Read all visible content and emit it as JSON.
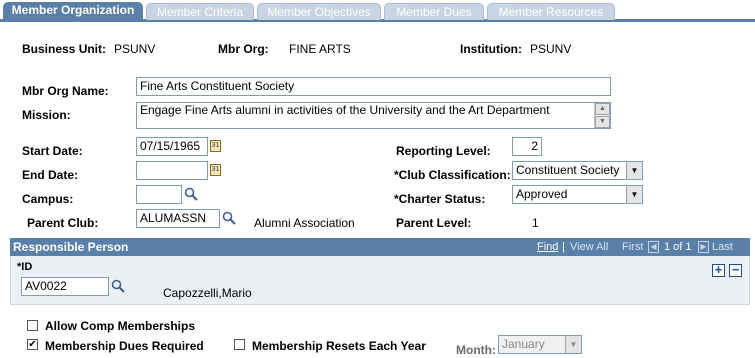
{
  "tabs": [
    {
      "label": "Member Organization",
      "active": true
    },
    {
      "label": "Member Criteria",
      "active": false
    },
    {
      "label": "Member Objectives",
      "active": false
    },
    {
      "label": "Member Dues",
      "active": false
    },
    {
      "label": "Member Resources",
      "active": false
    }
  ],
  "header": {
    "business_unit_label": "Business Unit:",
    "business_unit_value": "PSUNV",
    "mbr_org_label": "Mbr Org:",
    "mbr_org_value": "FINE ARTS",
    "institution_label": "Institution:",
    "institution_value": "PSUNV"
  },
  "form": {
    "mbr_org_name_label": "Mbr Org Name:",
    "mbr_org_name_value": "Fine Arts Constituent Society",
    "mission_label": "Mission:",
    "mission_value": "Engage Fine Arts alumni in activities of the University and the Art Department",
    "start_date_label": "Start Date:",
    "start_date_value": "07/15/1965",
    "end_date_label": "End Date:",
    "end_date_value": "",
    "campus_label": "Campus:",
    "campus_value": "",
    "parent_club_label": "Parent Club:",
    "parent_club_value": "ALUMASSN",
    "parent_club_desc": "Alumni Association",
    "reporting_level_label": "Reporting Level:",
    "reporting_level_value": "2",
    "club_classification_label": "*Club Classification:",
    "club_classification_value": "Constituent Society",
    "charter_status_label": "*Charter Status:",
    "charter_status_value": "Approved",
    "parent_level_label": "Parent Level:",
    "parent_level_value": "1"
  },
  "responsible_person": {
    "title": "Responsible Person",
    "find_label": "Find",
    "separator": "|",
    "view_all_label": "View All",
    "first_label": "First",
    "range_label": "1 of 1",
    "last_label": "Last",
    "id_label": "*ID",
    "id_value": "AV0022",
    "name_value": "Capozzelli,Mario"
  },
  "options": {
    "allow_comp_label": "Allow Comp Memberships",
    "allow_comp_checked": false,
    "dues_required_label": "Membership Dues Required",
    "dues_required_checked": true,
    "resets_label": "Membership Resets Each Year",
    "resets_checked": false,
    "month_label": "Month:",
    "month_value": "January"
  },
  "colors": {
    "tab_active": "#5a7fa8",
    "tab_inactive": "#c8d4e3",
    "grid_body": "#ecf0f5"
  }
}
